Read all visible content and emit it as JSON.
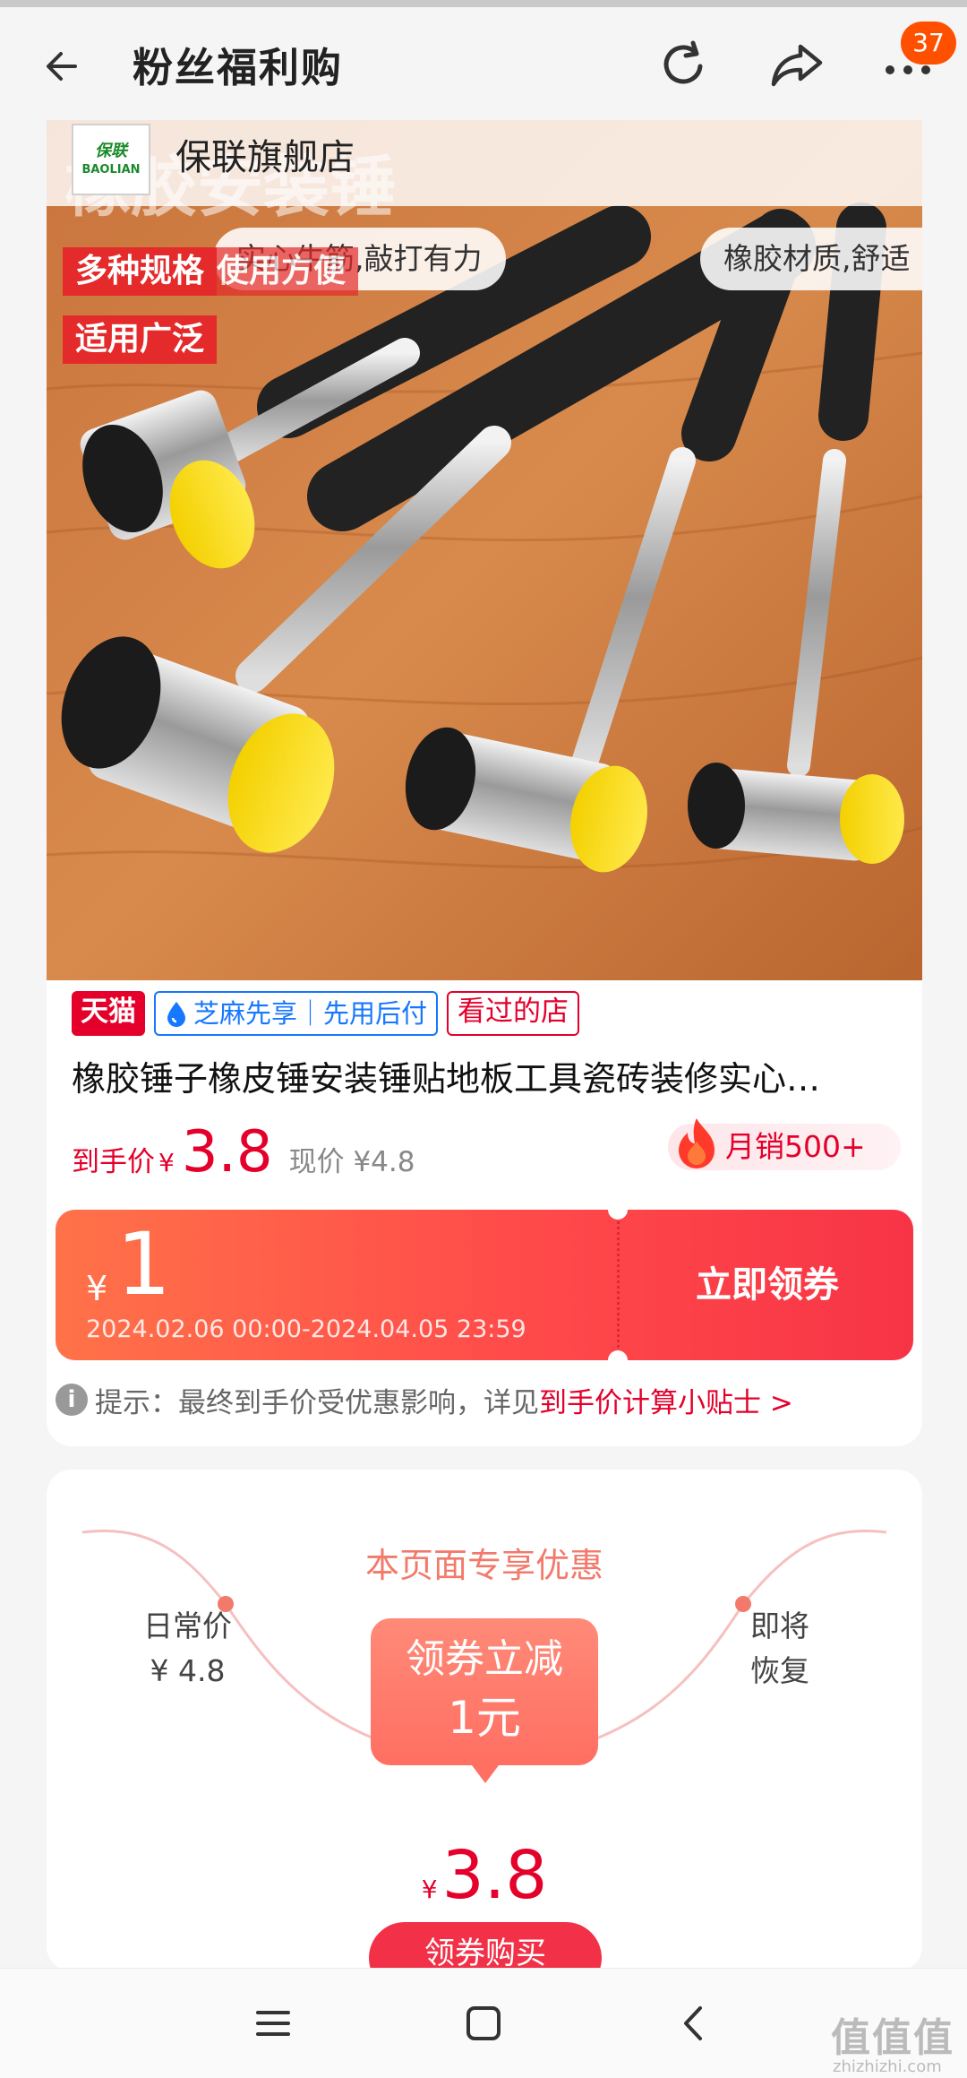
{
  "header": {
    "title": "粉丝福利购",
    "badge_count": "37"
  },
  "store": {
    "logo_text_cn": "保联",
    "logo_text_en": "BAOLIAN",
    "name": "保联旗舰店"
  },
  "hero": {
    "banner_text": "橡胶安装锤",
    "feature_pills": [
      "实心牛筋,敲打有力",
      "橡胶材质,舒适"
    ],
    "overlay_tags": [
      "多种规格",
      "使用方便",
      "适用广泛"
    ]
  },
  "product": {
    "tags": {
      "tmall": "天猫",
      "zhima": "芝麻先享｜先用后付",
      "seen": "看过的店"
    },
    "title": "橡胶锤子橡皮锤安装锤贴地板工具瓷砖装修实心…",
    "price_label": "到手价",
    "price_currency": "¥",
    "price_value": "3.8",
    "current_price": "现价 ¥4.8",
    "monthly_sales": "月销500+"
  },
  "coupon": {
    "currency": "¥",
    "value": "1",
    "validity": "2024.02.06 00:00-2024.04.05 23:59",
    "button_label": "立即领券"
  },
  "tip": {
    "icon": "info-icon",
    "text": "提示：最终到手价受优惠影响，详见",
    "link_text": "到手价计算小贴士 >"
  },
  "exclusive": {
    "title": "本页面专享优惠",
    "left_label": "日常价",
    "left_price": "¥ 4.8",
    "right_label_1": "即将",
    "right_label_2": "恢复",
    "box_title": "领券立减",
    "box_value": "1元",
    "final_currency": "¥",
    "final_price": "3.8",
    "buy_button": "领券购买"
  },
  "watermark": {
    "text": "值值值",
    "url": "zhizhizhi.com"
  },
  "colors": {
    "accent_red": "#e4002b",
    "coupon_start": "#ff7249",
    "coupon_end": "#f73446",
    "soft_red": "#f27a6b"
  }
}
